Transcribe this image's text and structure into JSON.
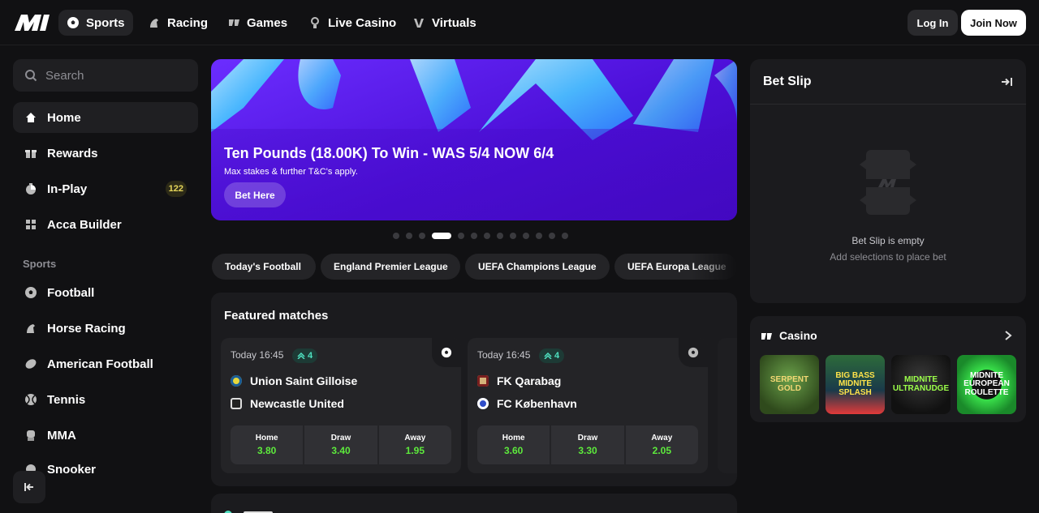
{
  "nav": {
    "tabs": [
      {
        "label": "Sports",
        "icon": "soccer-ball-icon"
      },
      {
        "label": "Racing",
        "icon": "horse-icon"
      },
      {
        "label": "Games",
        "icon": "dice-icon"
      },
      {
        "label": "Live Casino",
        "icon": "dealer-icon"
      },
      {
        "label": "Virtuals",
        "icon": "virtuals-icon"
      }
    ],
    "login_label": "Log In",
    "join_label": "Join Now"
  },
  "sidebar": {
    "search_placeholder": "Search",
    "items": [
      {
        "label": "Home",
        "icon": "home-icon"
      },
      {
        "label": "Rewards",
        "icon": "gift-icon"
      },
      {
        "label": "In-Play",
        "icon": "stopwatch-icon",
        "badge": "122"
      },
      {
        "label": "Acca Builder",
        "icon": "grid-icon"
      }
    ],
    "sports_heading": "Sports",
    "sports": [
      {
        "label": "Football",
        "icon": "soccer-ball-icon"
      },
      {
        "label": "Horse Racing",
        "icon": "horse-icon"
      },
      {
        "label": "American Football",
        "icon": "american-football-icon"
      },
      {
        "label": "Tennis",
        "icon": "tennis-ball-icon"
      },
      {
        "label": "MMA",
        "icon": "glove-icon"
      },
      {
        "label": "Snooker",
        "icon": "snooker-icon"
      }
    ]
  },
  "banner": {
    "title": "Ten Pounds (18.00K) To Win - WAS 5/4 NOW 6/4",
    "subtitle": "Max stakes & further T&C's apply.",
    "cta": "Bet Here",
    "slide_count": 13,
    "active_slide": 3
  },
  "chips": [
    "Today's Football",
    "England Premier League",
    "UEFA Champions League",
    "UEFA Europa League"
  ],
  "featured": {
    "title": "Featured matches",
    "matches": [
      {
        "time": "Today 16:45",
        "markets": "4",
        "home": "Union Saint Gilloise",
        "away": "Newcastle United",
        "odds": [
          {
            "label": "Home",
            "value": "3.80"
          },
          {
            "label": "Draw",
            "value": "3.40"
          },
          {
            "label": "Away",
            "value": "1.95"
          }
        ]
      },
      {
        "time": "Today 16:45",
        "markets": "4",
        "home": "FK Qarabag",
        "away": "FC København",
        "odds": [
          {
            "label": "Home",
            "value": "3.60"
          },
          {
            "label": "Draw",
            "value": "3.30"
          },
          {
            "label": "Away",
            "value": "2.05"
          }
        ]
      }
    ]
  },
  "betslip": {
    "title": "Bet Slip",
    "empty_title": "Bet Slip is empty",
    "empty_hint": "Add selections to place bet"
  },
  "casino": {
    "title": "Casino",
    "games": [
      {
        "name": "SERPENT GOLD"
      },
      {
        "name": "BIG BASS MIDNITE SPLASH"
      },
      {
        "name": "MIDNITE ULTRANUDGE"
      },
      {
        "name": "MIDNITE EUROPEAN ROULETTE"
      }
    ]
  },
  "colors": {
    "background": "#111113",
    "panel": "#1b1b1e",
    "odds_green": "#5dea3c",
    "badge_yellow": "#e6d65a",
    "banner_purple": "#5a16e8"
  }
}
